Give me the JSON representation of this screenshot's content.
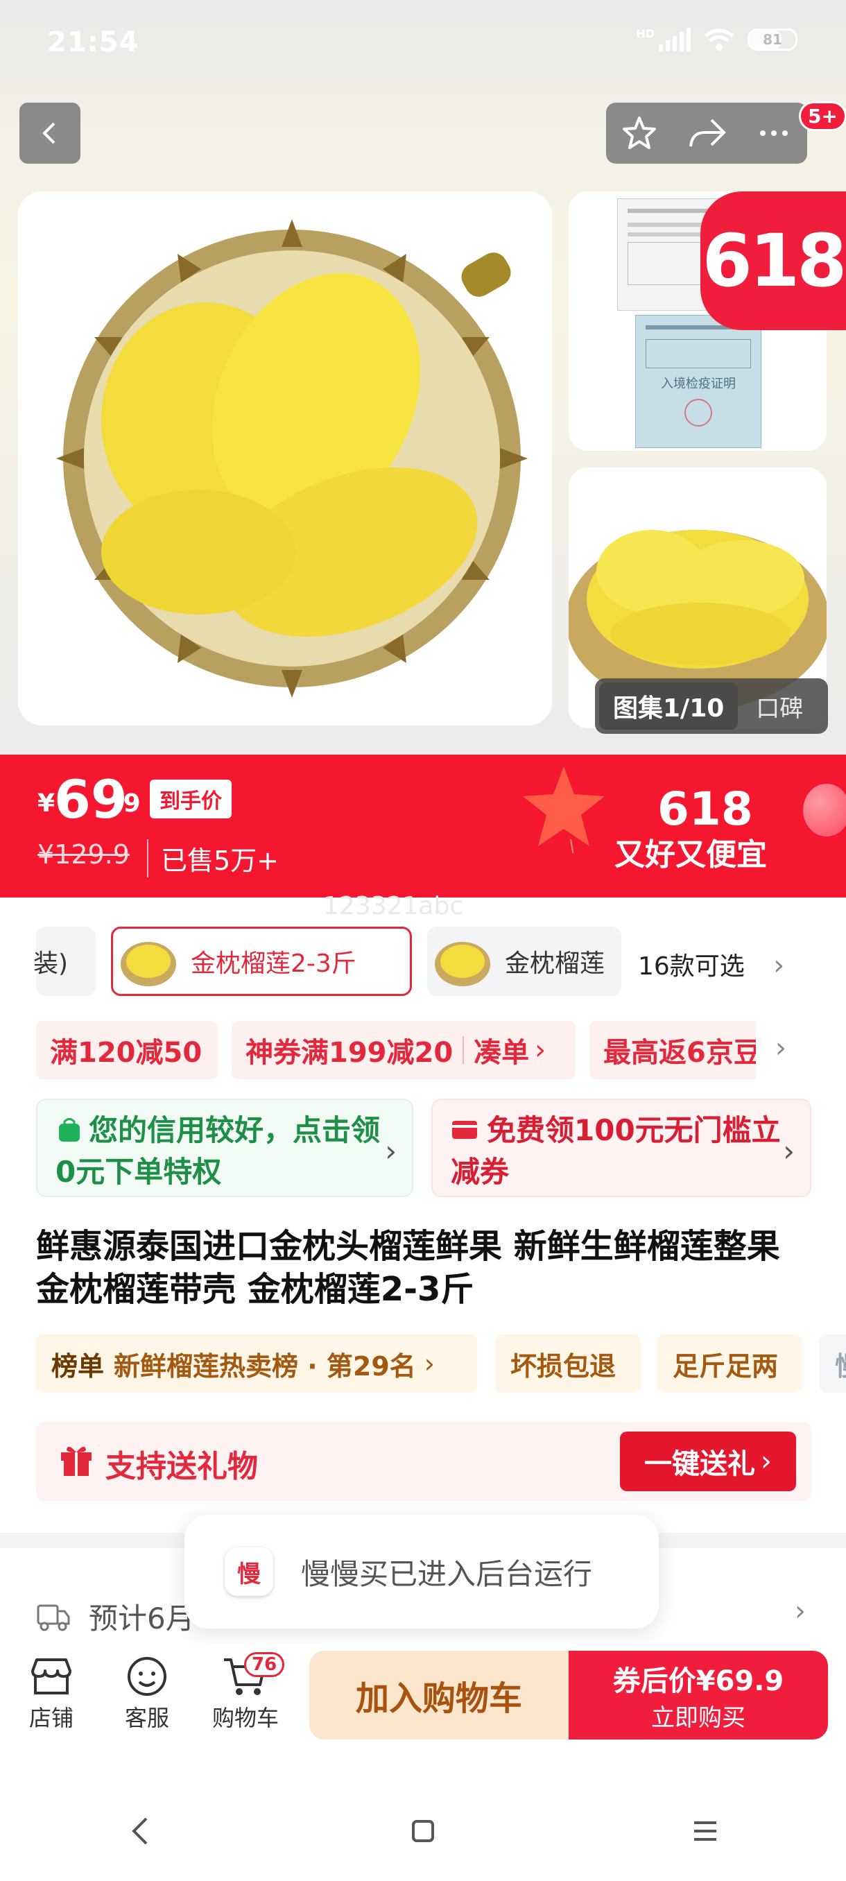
{
  "status_bar": {
    "time": "21:54",
    "network": "HD",
    "battery": "81"
  },
  "header": {
    "badge_count": "5+"
  },
  "gallery": {
    "badge_618": "618",
    "thumb_doc_caption": "入境检疫证明",
    "counter": "图集1/10",
    "reviews_tab": "口碑"
  },
  "price": {
    "currency": "¥",
    "integer": "69",
    "decimal": ".9",
    "tag": "到手价",
    "original": "¥129.9",
    "sold": "已售5万+",
    "promo_title": "618",
    "promo_sub": "又好又便宜"
  },
  "watermark": "123321abc",
  "sku": {
    "prev_label": "装)",
    "selected_label": "金枕榴莲2-3斤",
    "next_label": "金枕榴莲",
    "count_label": "16款可选"
  },
  "coupons": {
    "c1": "满120减50",
    "c2": "神券满199减20",
    "c2_action": "凑单",
    "c3": "最高返6京豆"
  },
  "credit": {
    "green": "您的信用较好，点击领0元下单特权",
    "red": "免费领100元无门槛立减券"
  },
  "product_title": "鲜惠源泰国进口金枕头榴莲鲜果 新鲜生鲜榴莲整果金枕榴莲带壳 金枕榴莲2-3斤",
  "tags": {
    "rank_label": "榜单",
    "rank_text": "新鲜榴莲热卖榜 · 第29名",
    "t2": "坏损包退",
    "t3": "足斤足两",
    "t4": "慢"
  },
  "gift": {
    "label": "支持送礼物",
    "button": "一键送礼"
  },
  "toast": {
    "icon_text": "慢",
    "text": "慢慢买已进入后台运行"
  },
  "delivery": {
    "text": "预计6月"
  },
  "bottom_bar": {
    "shop": "店铺",
    "service": "客服",
    "cart": "购物车",
    "cart_count": "76",
    "add_cart": "加入购物车",
    "buy_line1": "券后价¥69.9",
    "buy_line2": "立即购买"
  },
  "colors": {
    "brand_red": "#f4172f",
    "green": "#1d8f46",
    "gold": "#a35a10"
  }
}
